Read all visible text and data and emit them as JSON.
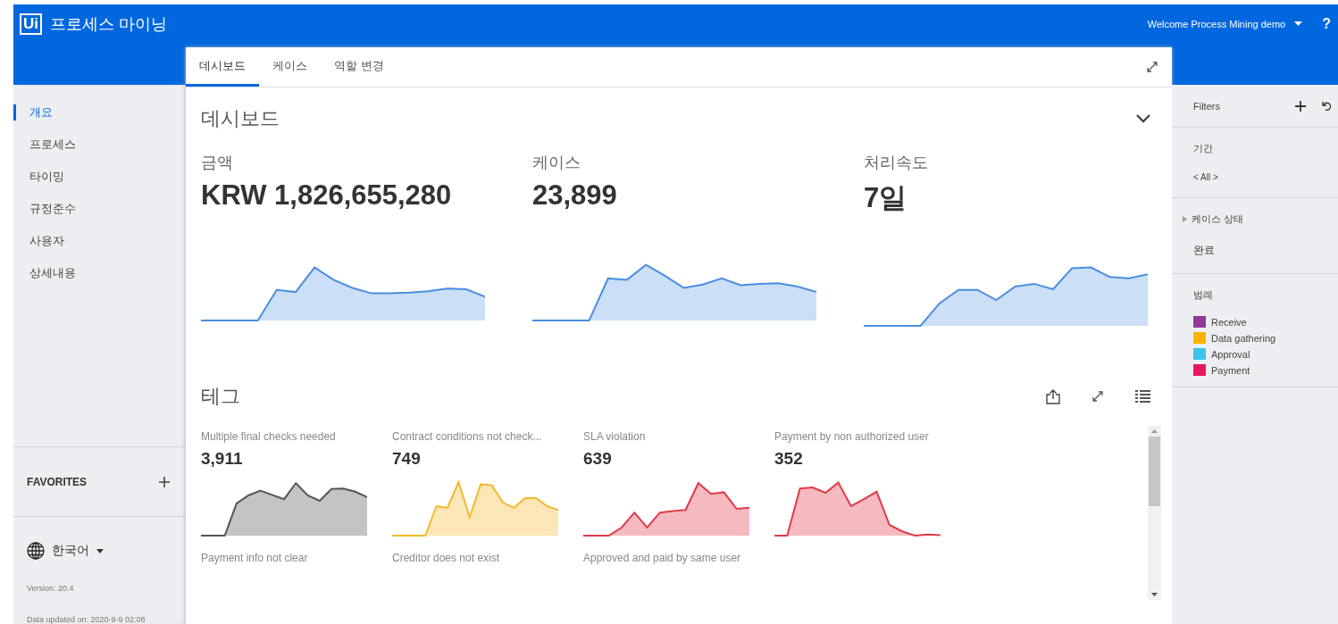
{
  "header": {
    "logo": "Ui",
    "title": "프로세스 마이닝",
    "user": "Welcome Process Mining demo",
    "help": "?"
  },
  "tabs": [
    {
      "label": "데시보드",
      "selected": true
    },
    {
      "label": "케이스",
      "selected": false
    },
    {
      "label": "역할 변경",
      "selected": false
    }
  ],
  "sidebar": {
    "items": [
      {
        "label": "개요",
        "selected": true
      },
      {
        "label": "프로세스",
        "selected": false
      },
      {
        "label": "타이밍",
        "selected": false
      },
      {
        "label": "규정준수",
        "selected": false
      },
      {
        "label": "사용자",
        "selected": false
      },
      {
        "label": "상세내용",
        "selected": false
      }
    ],
    "favorites": "FAVORITES",
    "language": "한국어",
    "version": "Version: 20.4",
    "data_updated": "Data updated on: 2020-9-9 02:08"
  },
  "dashboard": {
    "title": "데시보드",
    "kpis": [
      {
        "label": "금액",
        "value": "KRW 1,826,655,280"
      },
      {
        "label": "케이스",
        "value": "23,899"
      },
      {
        "label": "처리속도",
        "value": "7일"
      }
    ]
  },
  "tags": {
    "title": "테그",
    "items": [
      {
        "label": "Multiple final checks needed",
        "value": "3,911",
        "color": "#555555"
      },
      {
        "label": "Contract conditions not check...",
        "value": "749",
        "color": "#f5b82e"
      },
      {
        "label": "SLA violation",
        "value": "639",
        "color": "#e23a48"
      },
      {
        "label": "Payment by non authorized user",
        "value": "352",
        "color": "#e23a48"
      },
      {
        "label": "Payment info not clear"
      },
      {
        "label": "Creditor does not exist"
      },
      {
        "label": "Approved and paid by same user"
      }
    ]
  },
  "filters": {
    "title": "Filters",
    "sections": [
      {
        "title": "기간",
        "value": "< All >"
      },
      {
        "title": "케이스 상태",
        "value": "완료"
      }
    ],
    "legend": {
      "title": "범례",
      "items": [
        {
          "label": "Receive",
          "color": "#8e3a96"
        },
        {
          "label": "Data gathering",
          "color": "#ffb300"
        },
        {
          "label": "Approval",
          "color": "#3cc4ee"
        },
        {
          "label": "Payment",
          "color": "#e8175d"
        }
      ]
    }
  }
}
